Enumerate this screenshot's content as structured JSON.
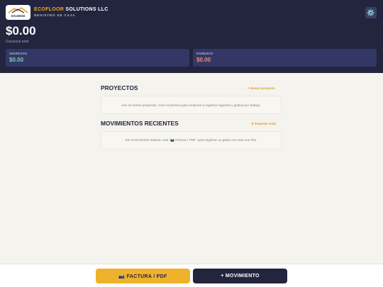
{
  "header": {
    "logo_text": "SALWADI",
    "brand_accent": "ECOFLOOR",
    "brand_rest": " SOLUTIONS LLC",
    "subtitle": "REGISTRO DE CAJA",
    "settings_icon": "⚙️",
    "total_value": "$0.00",
    "total_label": "Ganancia total",
    "ingresos_title": "INGRESOS",
    "ingresos_value": "$0.00",
    "egresos_title": "EGRESOS",
    "egresos_value": "$0.00"
  },
  "projects": {
    "title": "PROYECTOS",
    "new_link": "+ Nuevo proyecto",
    "empty_text": "Aún no tienes proyectos. Crea el primero para empezar a registrar ingresos y gastos por trabajo."
  },
  "movements": {
    "title": "MOVIMIENTOS RECIENTES",
    "export_link": "⬇ Exportar todo",
    "empty_text": "Sin movimientos todavía. Usa \"📷 Factura / PDF\" para registrar un gasto con solo una foto."
  },
  "footer": {
    "factura_label": "📷 FACTURA / PDF",
    "movimiento_label": "+ MOVIMIENTO"
  },
  "colors": {
    "header_bg": "#23253e",
    "card_bg": "#323766",
    "accent": "#f5a623",
    "income": "#6fd69a",
    "expense": "#f08a7a",
    "page_bg": "#f5f3ee"
  }
}
